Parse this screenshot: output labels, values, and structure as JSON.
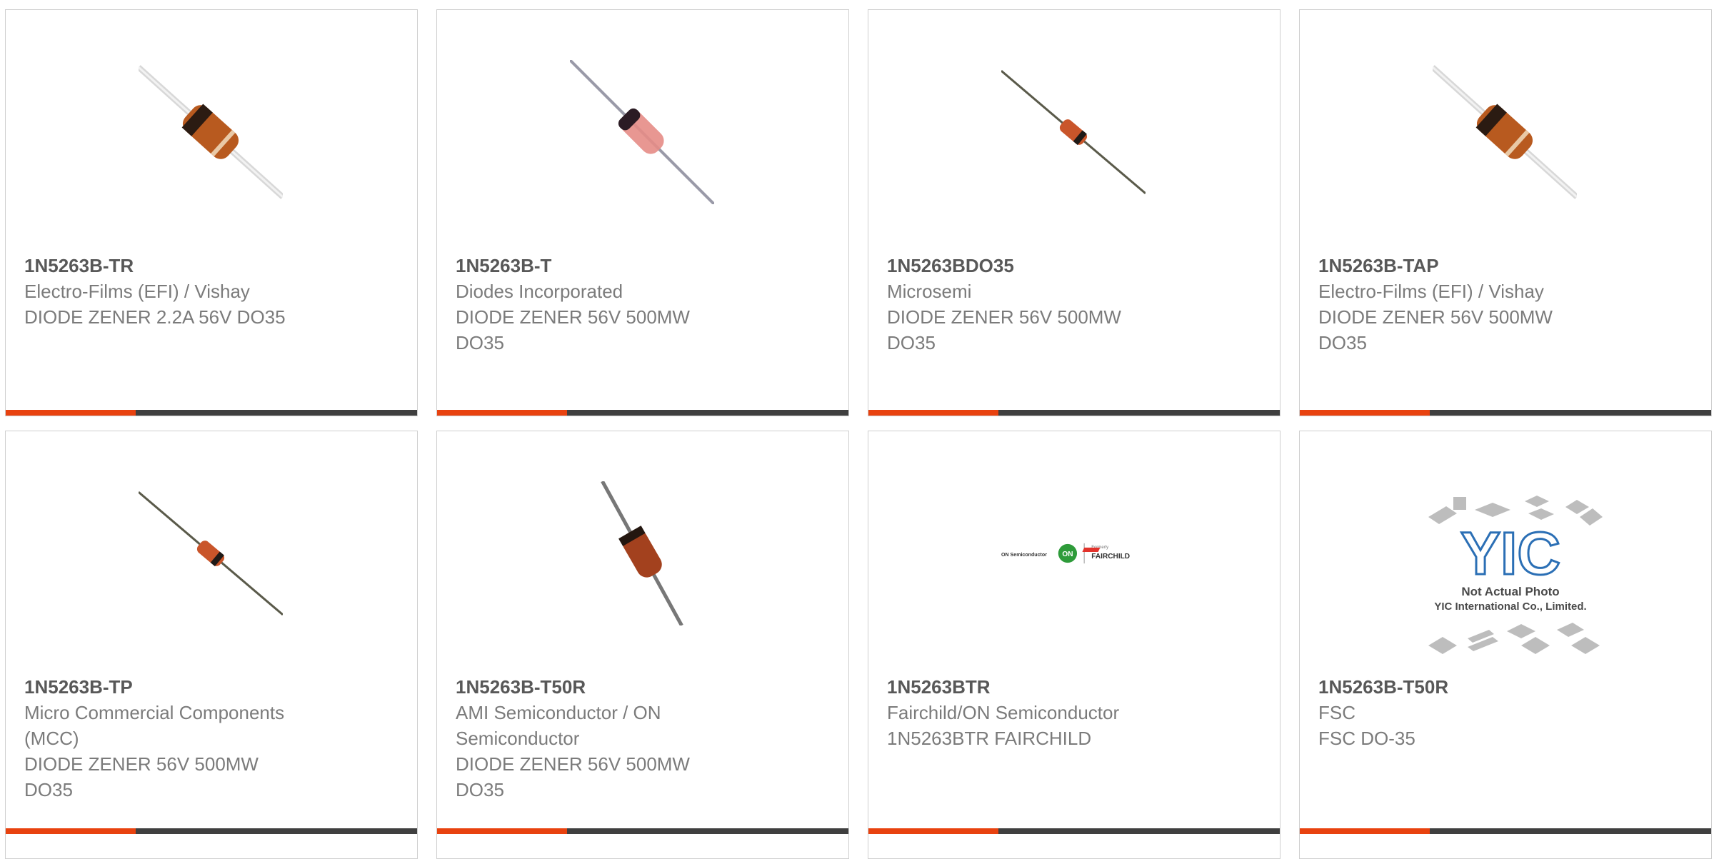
{
  "colors": {
    "accent": "#e8420f",
    "bar_dark": "#3f3f3f",
    "part_number": "#585858",
    "meta_text": "#7b7b7b",
    "border": "#cfcfcf"
  },
  "cards": [
    {
      "part": "1N5263B-TR",
      "maker": "Electro-Films (EFI) / Vishay",
      "desc1": "DIODE ZENER 2.2A 56V DO35",
      "desc2": "",
      "image": "brown-diode-icon"
    },
    {
      "part": "1N5263B-T",
      "maker": "Diodes Incorporated",
      "desc1": "DIODE ZENER 56V 500MW",
      "desc2": "DO35",
      "image": "pink-glass-diode-icon"
    },
    {
      "part": "1N5263BDO35",
      "maker": "Microsemi",
      "desc1": "DIODE ZENER 56V 500MW",
      "desc2": "DO35",
      "image": "small-diode-icon"
    },
    {
      "part": "1N5263B-TAP",
      "maker": "Electro-Films (EFI) / Vishay",
      "desc1": "DIODE ZENER 56V 500MW",
      "desc2": "DO35",
      "image": "brown-diode-icon"
    },
    {
      "part": "1N5263B-TP",
      "maker": "Micro Commercial Components",
      "maker2": "(MCC)",
      "desc1": "DIODE ZENER 56V 500MW",
      "desc2": "DO35",
      "image": "small-diode-icon"
    },
    {
      "part": "1N5263B-T50R",
      "maker": "AMI Semiconductor / ON",
      "maker2": "Semiconductor",
      "desc1": "DIODE ZENER 56V 500MW",
      "desc2": "DO35",
      "image": "glass-diode-icon"
    },
    {
      "part": "1N5263BTR",
      "maker": "Fairchild/ON Semiconductor",
      "desc1": "1N5263BTR FAIRCHILD",
      "desc2": "",
      "image": "onsemi-fairchild-logo"
    },
    {
      "part": "1N5263B-T50R",
      "maker": "FSC",
      "desc1": "FSC DO-35",
      "desc2": "",
      "image": "yic-placeholder-logo"
    }
  ],
  "logos": {
    "onsemi_small": "ON Semiconductor",
    "on_mark": "ON",
    "formerly": "Formerly",
    "fairchild": "FAIRCHILD",
    "yic_mark": "YIC",
    "yic_line1": "Not Actual Photo",
    "yic_line2": "YIC International Co., Limited."
  }
}
